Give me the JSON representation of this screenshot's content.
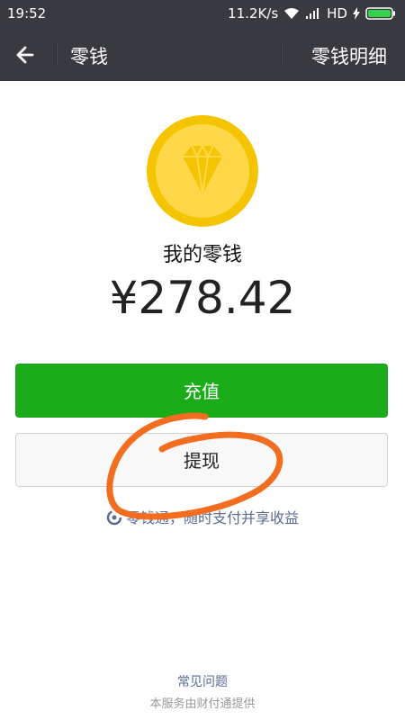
{
  "status_bar": {
    "time": "19:52",
    "network_speed": "11.2K/s",
    "network_type": "HD",
    "icons": [
      "wifi-icon",
      "signal-icon",
      "charging-icon",
      "battery-icon"
    ]
  },
  "header": {
    "back_icon": "back-arrow-icon",
    "title": "零钱",
    "detail_link": "零钱明细"
  },
  "wallet": {
    "coin_icon": "diamond-coin-icon",
    "balance_label": "我的零钱",
    "balance": "¥278.42"
  },
  "actions": {
    "recharge_label": "充值",
    "withdraw_label": "提现"
  },
  "promo": {
    "icon": "lingqiantong-icon",
    "text": "零钱通，随时支付并享收益"
  },
  "footer": {
    "faq_label": "常见问题",
    "provider_text": "本服务由财付通提供"
  },
  "colors": {
    "header_bg": "#393a3f",
    "primary_green": "#1aad19",
    "link_blue": "#576b95",
    "coin_yellow": "#f5c400",
    "annotation_orange": "#f26d1f"
  }
}
